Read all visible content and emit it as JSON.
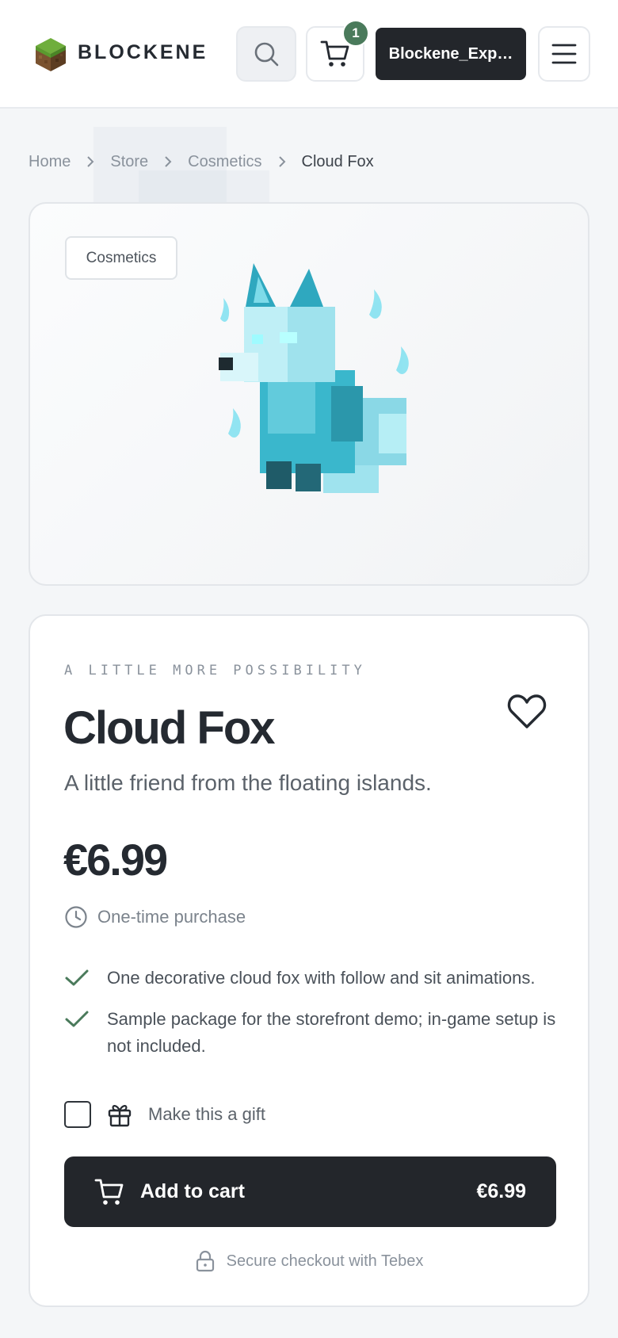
{
  "header": {
    "brand": "BLOCKENE",
    "cart_count": "1",
    "user_label": "Blockene_Exp…",
    "icons": [
      "grass-block-logo",
      "search-icon",
      "cart-icon",
      "menu-icon"
    ]
  },
  "breadcrumb": {
    "items": [
      "Home",
      "Store",
      "Cosmetics"
    ],
    "current": "Cloud Fox"
  },
  "product": {
    "category_tag": "Cosmetics",
    "eyebrow": "A LITTLE MORE POSSIBILITY",
    "title": "Cloud Fox",
    "subtitle": "A little friend from the floating islands.",
    "price": "€6.99",
    "purchase_type": "One-time purchase",
    "features": [
      "One decorative cloud fox with follow and sit animations.",
      "Sample package for the storefront demo; in-game setup is not included."
    ],
    "gift_label": "Make this a gift",
    "gift_checked": false,
    "add_to_cart_label": "Add to cart",
    "add_to_cart_price": "€6.99",
    "secure_note": "Secure checkout with Tebex"
  },
  "colors": {
    "dark": "#23262b",
    "badge_green": "#4a7a5b",
    "fox_cyan": "#5fd3e6"
  }
}
